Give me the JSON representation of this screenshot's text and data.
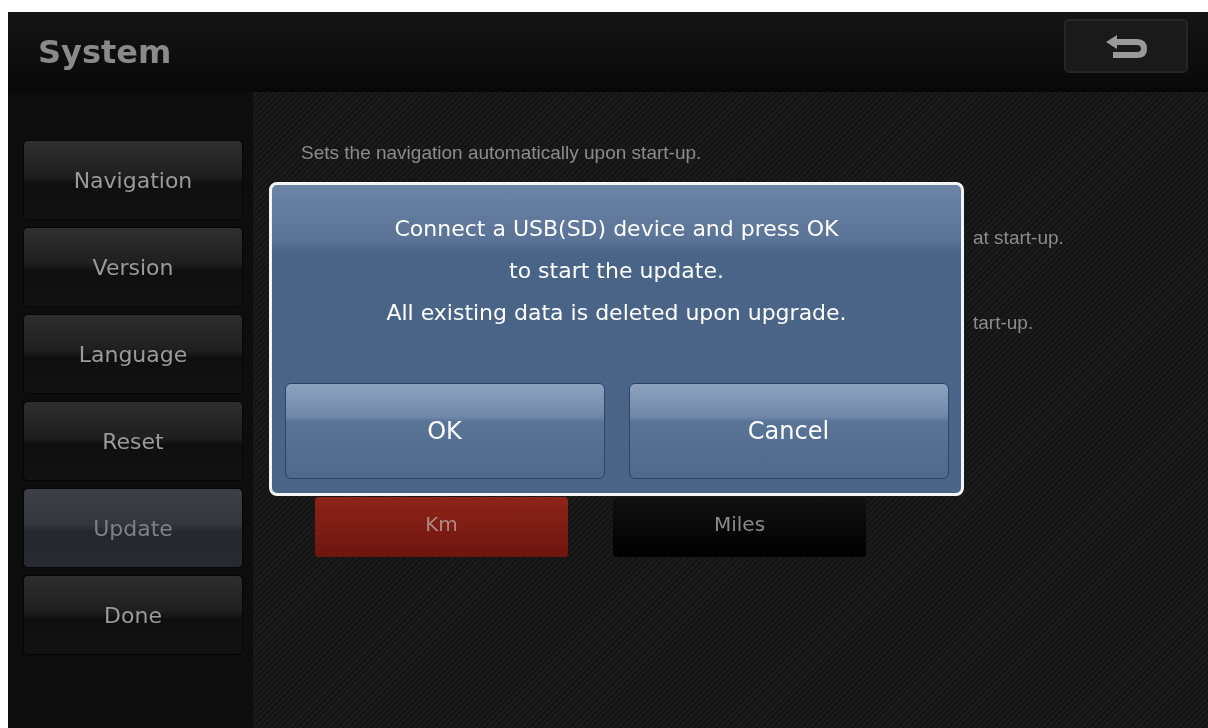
{
  "header": {
    "title": "System"
  },
  "sidebar": {
    "items": [
      {
        "label": "Navigation",
        "selected": false
      },
      {
        "label": "Version",
        "selected": false
      },
      {
        "label": "Language",
        "selected": false
      },
      {
        "label": "Reset",
        "selected": false
      },
      {
        "label": "Update",
        "selected": true
      },
      {
        "label": "Done",
        "selected": false
      }
    ]
  },
  "content": {
    "descriptions": [
      "Sets the navigation automatically upon start-up.",
      "at start-up.",
      "tart-up."
    ],
    "units": [
      {
        "label": "Km",
        "selected": true
      },
      {
        "label": "Miles",
        "selected": false
      }
    ]
  },
  "dialog": {
    "lines": [
      "Connect a USB(SD) device and press OK",
      "to start the update.",
      "All existing data is deleted upon upgrade."
    ],
    "buttons": [
      "OK",
      "Cancel"
    ]
  }
}
